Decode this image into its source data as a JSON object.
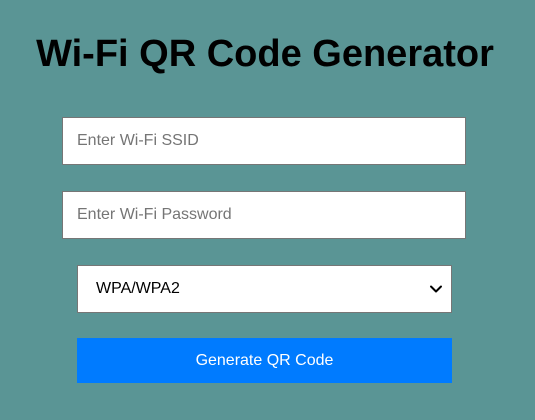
{
  "page": {
    "title": "Wi-Fi QR Code Generator"
  },
  "form": {
    "ssid": {
      "value": "",
      "placeholder": "Enter Wi-Fi SSID"
    },
    "password": {
      "value": "",
      "placeholder": "Enter Wi-Fi Password"
    },
    "encryption": {
      "selected": "WPA/WPA2",
      "icon": "chevron-down-icon"
    },
    "generate_button_label": "Generate QR Code"
  },
  "colors": {
    "background": "#5a9595",
    "button": "#007bff",
    "button_text": "#ffffff"
  }
}
